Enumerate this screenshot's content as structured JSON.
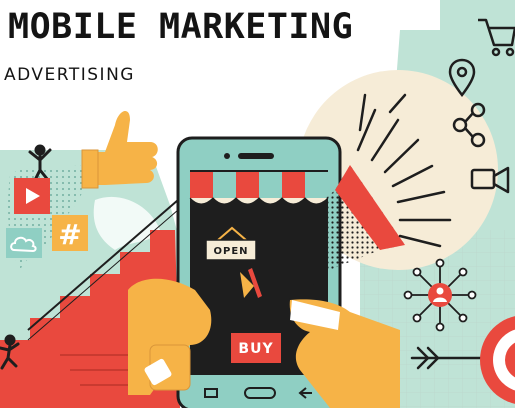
{
  "title": "MOBILE MARKETING",
  "subtitle": "ADVERTISING",
  "sign_label": "OPEN",
  "button_label": "BUY",
  "hashtag": "#",
  "colors": {
    "mint": "#bfe3d6",
    "teal": "#8fcfc3",
    "red": "#e9493e",
    "orange": "#f6b347",
    "cream": "#f6ecd7",
    "dark": "#1e1e1e"
  },
  "icons": [
    "shopping-cart-icon",
    "location-pin-icon",
    "share-icon",
    "video-camera-icon",
    "user-network-icon",
    "thumbs-up-icon",
    "play-icon",
    "cloud-icon",
    "hashtag-icon",
    "megaphone-icon",
    "arrow-icon",
    "target-icon"
  ]
}
